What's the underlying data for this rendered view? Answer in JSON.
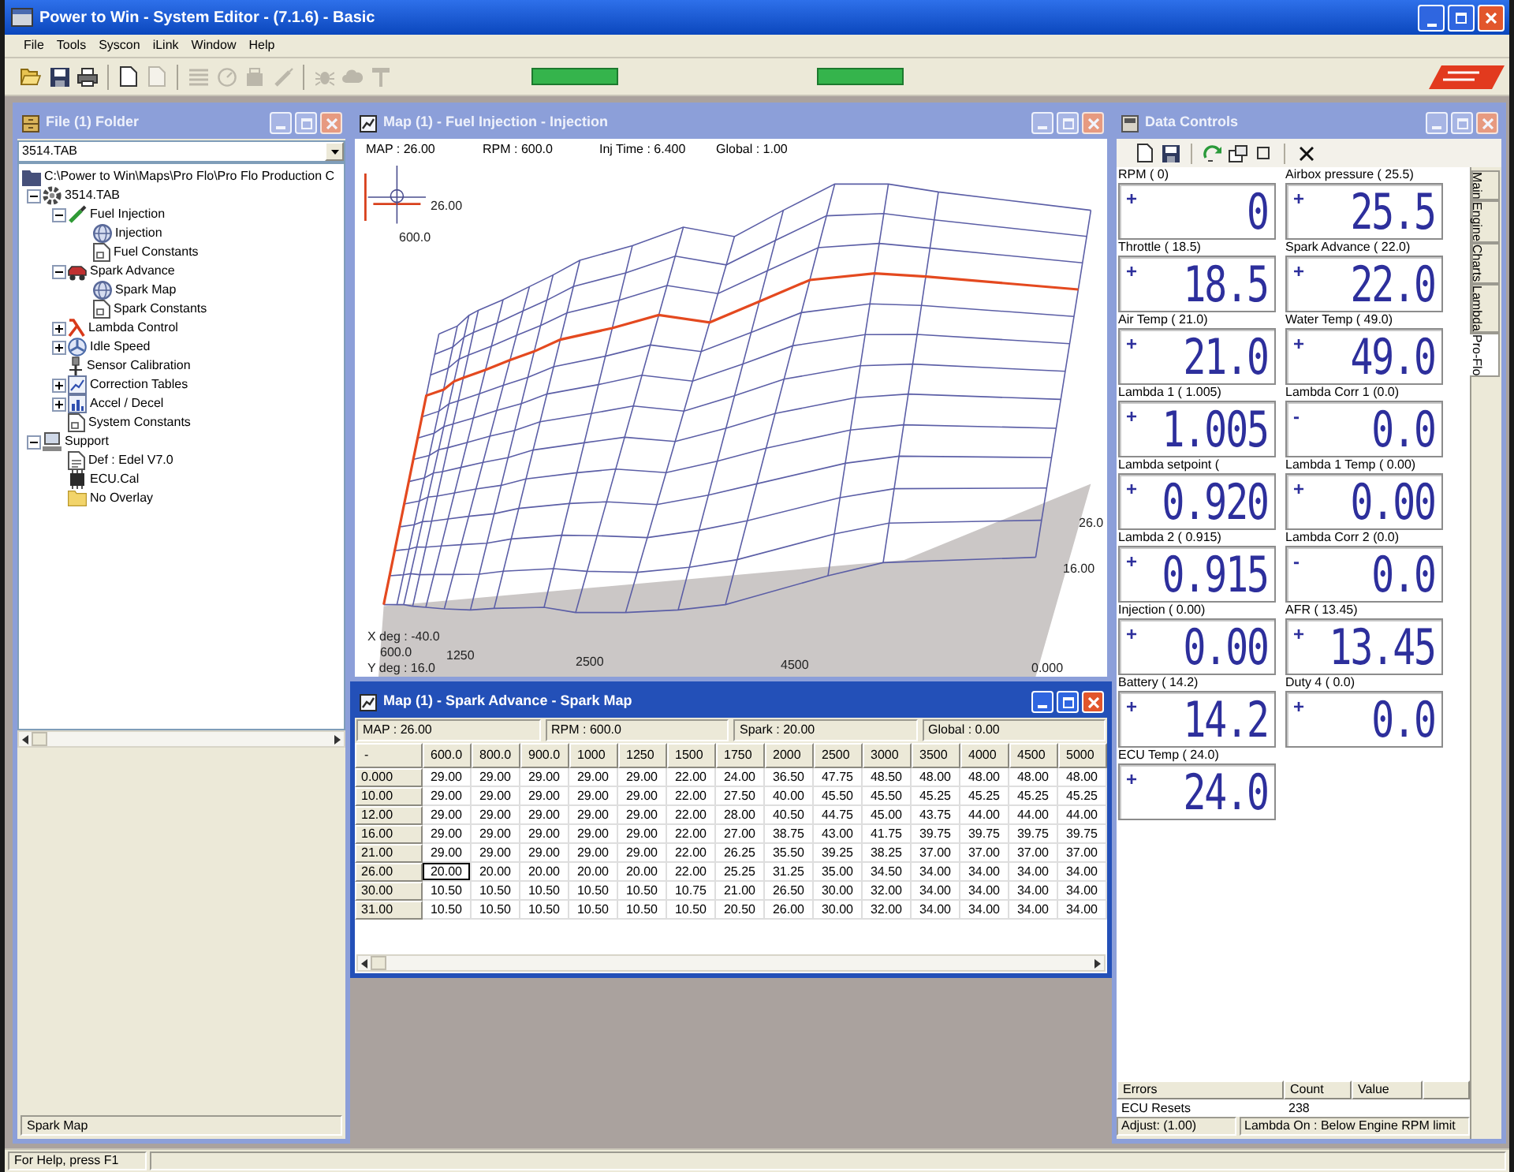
{
  "app": {
    "title": "Power to Win - System Editor - (7.1.6) - Basic",
    "menu": [
      "File",
      "Tools",
      "Syscon",
      "iLink",
      "Window",
      "Help"
    ]
  },
  "toolbar": {
    "groups": [
      {
        "buttons": [
          {
            "kind": "open",
            "disabled": false
          },
          {
            "kind": "save",
            "disabled": false
          },
          {
            "kind": "print",
            "disabled": false
          }
        ]
      },
      {
        "buttons": [
          {
            "kind": "page",
            "disabled": false
          },
          {
            "kind": "copy",
            "disabled": true
          }
        ]
      },
      {
        "buttons": [
          {
            "kind": "list",
            "disabled": true
          },
          {
            "kind": "dial",
            "disabled": true
          },
          {
            "kind": "box",
            "disabled": true
          },
          {
            "kind": "pen",
            "disabled": true
          }
        ]
      },
      {
        "buttons": [
          {
            "kind": "bug",
            "disabled": true
          },
          {
            "kind": "cloud",
            "disabled": true
          },
          {
            "kind": "pin",
            "disabled": true
          }
        ]
      }
    ]
  },
  "folder_window": {
    "title": "File (1) Folder",
    "active": false,
    "file_select": "3514.TAB",
    "tree": [
      {
        "label": "C:\\Power to Win\\Maps\\Pro Flo\\Pro Flo Production C",
        "kind": "directory",
        "children": [
          {
            "label": "3514.TAB",
            "kind": "tablefile",
            "expanded": true,
            "children": [
              {
                "label": "Fuel Injection",
                "kind": "fuel",
                "expanded": true,
                "children": [
                  {
                    "label": "Injection",
                    "kind": "map"
                  },
                  {
                    "label": "Fuel Constants",
                    "kind": "constants"
                  }
                ]
              },
              {
                "label": "Spark Advance",
                "kind": "spark",
                "expanded": true,
                "children": [
                  {
                    "label": "Spark Map",
                    "kind": "map"
                  },
                  {
                    "label": "Spark Constants",
                    "kind": "constants"
                  }
                ]
              },
              {
                "label": "Lambda Control",
                "kind": "lambda",
                "expanded": false
              },
              {
                "label": "Idle Speed",
                "kind": "idle",
                "expanded": false
              },
              {
                "label": "Sensor Calibration",
                "kind": "sensor"
              },
              {
                "label": "Correction Tables",
                "kind": "correction",
                "expanded": false
              },
              {
                "label": "Accel / Decel",
                "kind": "accel",
                "expanded": false
              },
              {
                "label": "System Constants",
                "kind": "constants"
              }
            ]
          },
          {
            "label": "Support",
            "kind": "support",
            "expanded": true,
            "children": [
              {
                "label": "Def : Edel V7.0",
                "kind": "definition"
              },
              {
                "label": "ECU.Cal",
                "kind": "calibration"
              },
              {
                "label": "No Overlay",
                "kind": "overlay"
              }
            ]
          }
        ]
      }
    ],
    "status": "Spark Map"
  },
  "map_window": {
    "title": "Map (1) - Fuel Injection - Injection",
    "active": false,
    "readouts": [
      "MAP : 26.00",
      "RPM : 600.0",
      "Inj Time : 6.400",
      "Global : 1.00"
    ],
    "surface": {
      "cursor_map": "26.00",
      "cursor_rpm": "600.0",
      "map_axis": [
        "26.0",
        "16.00",
        "0.000"
      ],
      "rpm_axis": [
        "600.0",
        "1250",
        "2500",
        "4500"
      ],
      "x_deg": "X deg : -40.0",
      "y_deg": "Y deg : 16.0"
    }
  },
  "spark_window": {
    "title": "Map (1) - Spark Advance - Spark Map",
    "active": true,
    "readouts": [
      "MAP : 26.00",
      "RPM : 600.0",
      "Spark : 20.00",
      "Global : 0.00"
    ],
    "table": {
      "corner": "-",
      "columns": [
        "600.0",
        "800.0",
        "900.0",
        "1000",
        "1250",
        "1500",
        "1750",
        "2000",
        "2500",
        "3000",
        "3500",
        "4000",
        "4500",
        "5000"
      ],
      "rows": [
        {
          "label": "0.000",
          "cells": [
            {
              "value": "29.00",
              "selected": false
            },
            {
              "value": "29.00",
              "selected": false
            },
            {
              "value": "29.00",
              "selected": false
            },
            {
              "value": "29.00",
              "selected": false
            },
            {
              "value": "29.00",
              "selected": false
            },
            {
              "value": "22.00",
              "selected": false
            },
            {
              "value": "24.00",
              "selected": false
            },
            {
              "value": "36.50",
              "selected": false
            },
            {
              "value": "47.75",
              "selected": false
            },
            {
              "value": "48.50",
              "selected": false
            },
            {
              "value": "48.00",
              "selected": false
            },
            {
              "value": "48.00",
              "selected": false
            },
            {
              "value": "48.00",
              "selected": false
            },
            {
              "value": "48.00",
              "selected": false
            }
          ]
        },
        {
          "label": "10.00",
          "cells": [
            {
              "value": "29.00",
              "selected": false
            },
            {
              "value": "29.00",
              "selected": false
            },
            {
              "value": "29.00",
              "selected": false
            },
            {
              "value": "29.00",
              "selected": false
            },
            {
              "value": "29.00",
              "selected": false
            },
            {
              "value": "22.00",
              "selected": false
            },
            {
              "value": "27.50",
              "selected": false
            },
            {
              "value": "40.00",
              "selected": false
            },
            {
              "value": "45.50",
              "selected": false
            },
            {
              "value": "45.50",
              "selected": false
            },
            {
              "value": "45.25",
              "selected": false
            },
            {
              "value": "45.25",
              "selected": false
            },
            {
              "value": "45.25",
              "selected": false
            },
            {
              "value": "45.25",
              "selected": false
            }
          ]
        },
        {
          "label": "12.00",
          "cells": [
            {
              "value": "29.00",
              "selected": false
            },
            {
              "value": "29.00",
              "selected": false
            },
            {
              "value": "29.00",
              "selected": false
            },
            {
              "value": "29.00",
              "selected": false
            },
            {
              "value": "29.00",
              "selected": false
            },
            {
              "value": "22.00",
              "selected": false
            },
            {
              "value": "28.00",
              "selected": false
            },
            {
              "value": "40.50",
              "selected": false
            },
            {
              "value": "44.75",
              "selected": false
            },
            {
              "value": "45.00",
              "selected": false
            },
            {
              "value": "43.75",
              "selected": false
            },
            {
              "value": "44.00",
              "selected": false
            },
            {
              "value": "44.00",
              "selected": false
            },
            {
              "value": "44.00",
              "selected": false
            }
          ]
        },
        {
          "label": "16.00",
          "cells": [
            {
              "value": "29.00",
              "selected": false
            },
            {
              "value": "29.00",
              "selected": false
            },
            {
              "value": "29.00",
              "selected": false
            },
            {
              "value": "29.00",
              "selected": false
            },
            {
              "value": "29.00",
              "selected": false
            },
            {
              "value": "22.00",
              "selected": false
            },
            {
              "value": "27.00",
              "selected": false
            },
            {
              "value": "38.75",
              "selected": false
            },
            {
              "value": "43.00",
              "selected": false
            },
            {
              "value": "41.75",
              "selected": false
            },
            {
              "value": "39.75",
              "selected": false
            },
            {
              "value": "39.75",
              "selected": false
            },
            {
              "value": "39.75",
              "selected": false
            },
            {
              "value": "39.75",
              "selected": false
            }
          ]
        },
        {
          "label": "21.00",
          "cells": [
            {
              "value": "29.00",
              "selected": false
            },
            {
              "value": "29.00",
              "selected": false
            },
            {
              "value": "29.00",
              "selected": false
            },
            {
              "value": "29.00",
              "selected": false
            },
            {
              "value": "29.00",
              "selected": false
            },
            {
              "value": "22.00",
              "selected": false
            },
            {
              "value": "26.25",
              "selected": false
            },
            {
              "value": "35.50",
              "selected": false
            },
            {
              "value": "39.25",
              "selected": false
            },
            {
              "value": "38.25",
              "selected": false
            },
            {
              "value": "37.00",
              "selected": false
            },
            {
              "value": "37.00",
              "selected": false
            },
            {
              "value": "37.00",
              "selected": false
            },
            {
              "value": "37.00",
              "selected": false
            }
          ]
        },
        {
          "label": "26.00",
          "cells": [
            {
              "value": "20.00",
              "selected": true
            },
            {
              "value": "20.00",
              "selected": false
            },
            {
              "value": "20.00",
              "selected": false
            },
            {
              "value": "20.00",
              "selected": false
            },
            {
              "value": "20.00",
              "selected": false
            },
            {
              "value": "22.00",
              "selected": false
            },
            {
              "value": "25.25",
              "selected": false
            },
            {
              "value": "31.25",
              "selected": false
            },
            {
              "value": "35.00",
              "selected": false
            },
            {
              "value": "34.50",
              "selected": false
            },
            {
              "value": "34.00",
              "selected": false
            },
            {
              "value": "34.00",
              "selected": false
            },
            {
              "value": "34.00",
              "selected": false
            },
            {
              "value": "34.00",
              "selected": false
            }
          ]
        },
        {
          "label": "30.00",
          "cells": [
            {
              "value": "10.50",
              "selected": false
            },
            {
              "value": "10.50",
              "selected": false
            },
            {
              "value": "10.50",
              "selected": false
            },
            {
              "value": "10.50",
              "selected": false
            },
            {
              "value": "10.50",
              "selected": false
            },
            {
              "value": "10.75",
              "selected": false
            },
            {
              "value": "21.00",
              "selected": false
            },
            {
              "value": "26.50",
              "selected": false
            },
            {
              "value": "30.00",
              "selected": false
            },
            {
              "value": "32.00",
              "selected": false
            },
            {
              "value": "34.00",
              "selected": false
            },
            {
              "value": "34.00",
              "selected": false
            },
            {
              "value": "34.00",
              "selected": false
            },
            {
              "value": "34.00",
              "selected": false
            }
          ]
        },
        {
          "label": "31.00",
          "cells": [
            {
              "value": "10.50",
              "selected": false
            },
            {
              "value": "10.50",
              "selected": false
            },
            {
              "value": "10.50",
              "selected": false
            },
            {
              "value": "10.50",
              "selected": false
            },
            {
              "value": "10.50",
              "selected": false
            },
            {
              "value": "10.50",
              "selected": false
            },
            {
              "value": "20.50",
              "selected": false
            },
            {
              "value": "26.00",
              "selected": false
            },
            {
              "value": "30.00",
              "selected": false
            },
            {
              "value": "32.00",
              "selected": false
            },
            {
              "value": "34.00",
              "selected": false
            },
            {
              "value": "34.00",
              "selected": false
            },
            {
              "value": "34.00",
              "selected": false
            },
            {
              "value": "34.00",
              "selected": false
            }
          ]
        }
      ]
    }
  },
  "data_controls": {
    "title": "Data Controls",
    "active": false,
    "tabs": [
      {
        "label": "Main",
        "selected": false
      },
      {
        "label": "Engine",
        "selected": false
      },
      {
        "label": "Charts",
        "selected": false
      },
      {
        "label": "Lambda",
        "selected": false
      },
      {
        "label": "Pro-Flo",
        "selected": true
      }
    ],
    "gauges": [
      {
        "label": "RPM ( 0)",
        "sign": "+",
        "value": "0"
      },
      {
        "label": "Airbox pressure ( 25.5)",
        "sign": "+",
        "value": "25.5"
      },
      {
        "label": "Throttle ( 18.5)",
        "sign": "+",
        "value": "18.5"
      },
      {
        "label": "Spark Advance ( 22.0)",
        "sign": "+",
        "value": "22.0"
      },
      {
        "label": "Air Temp ( 21.0)",
        "sign": "+",
        "value": "21.0"
      },
      {
        "label": "Water Temp ( 49.0)",
        "sign": "+",
        "value": "49.0"
      },
      {
        "label": "Lambda 1 ( 1.005)",
        "sign": "+",
        "value": "1.005"
      },
      {
        "label": "Lambda Corr 1 (0.0)",
        "sign": "-",
        "value": "0.0"
      },
      {
        "label": "Lambda setpoint (",
        "sign": "+",
        "value": "0.920"
      },
      {
        "label": "Lambda 1 Temp ( 0.00)",
        "sign": "+",
        "value": "0.00"
      },
      {
        "label": "Lambda 2 ( 0.915)",
        "sign": "+",
        "value": "0.915"
      },
      {
        "label": "Lambda Corr 2 (0.0)",
        "sign": "-",
        "value": "0.0"
      },
      {
        "label": "Injection ( 0.00)",
        "sign": "+",
        "value": "0.00"
      },
      {
        "label": "AFR ( 13.45)",
        "sign": "+",
        "value": "13.45"
      },
      {
        "label": "Battery ( 14.2)",
        "sign": "+",
        "value": "14.2"
      },
      {
        "label": "Duty 4 ( 0.0)",
        "sign": "+",
        "value": "0.0"
      },
      {
        "label": "ECU Temp ( 24.0)",
        "sign": "+",
        "value": "24.0"
      }
    ],
    "errors": {
      "columns": [
        "Errors",
        "Count",
        "Value"
      ],
      "rows": [
        {
          "error": "ECU Resets",
          "count": "238"
        }
      ]
    },
    "adjust": "Adjust: (1.00)",
    "lambda_status": "Lambda On : Below Engine RPM limit"
  },
  "status_bar": "For Help, press F1"
}
